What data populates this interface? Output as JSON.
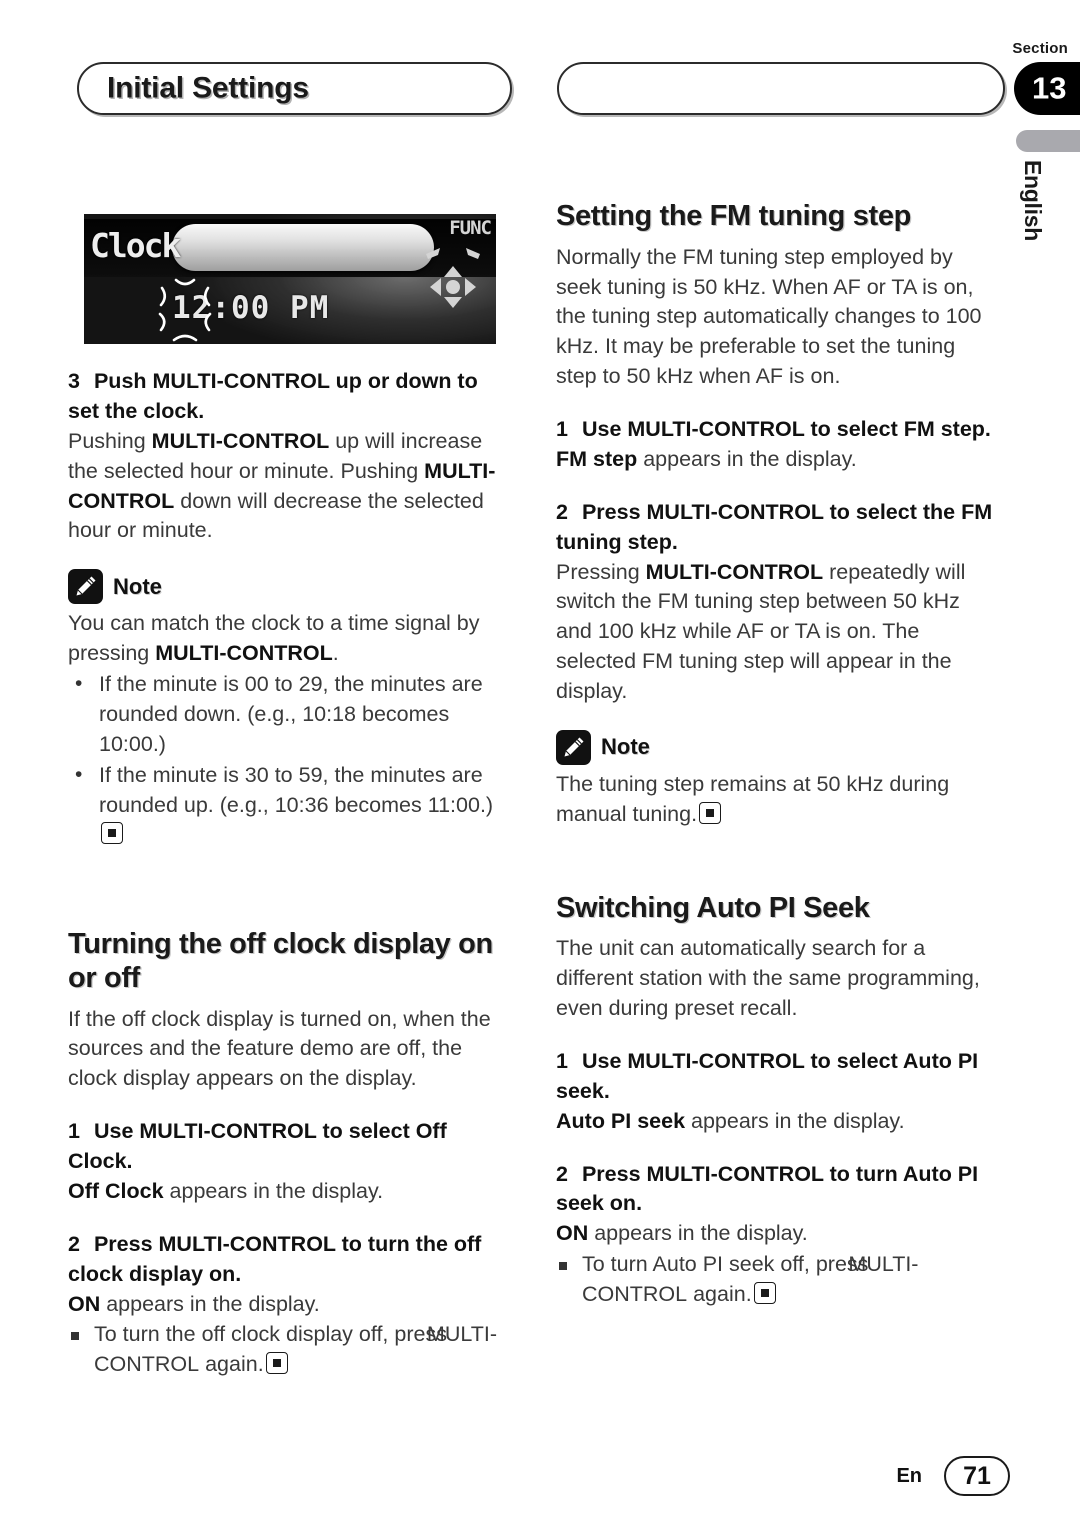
{
  "header": {
    "title": "Initial Settings",
    "right_pill_title": "",
    "section_label": "Section",
    "section_number": "13"
  },
  "side_tab": {
    "language": "English"
  },
  "lcd_display": {
    "alt": "car-stereo-lcd-clock-setting",
    "label_text": "Clock",
    "time_text": "12:00 PM",
    "func_text": "FUNC",
    "blink_indicator": "blinking-digits",
    "dpad_indicator": "multi-control-dpad"
  },
  "left_column": {
    "step3": {
      "num": "3",
      "heading": "Push MULTI-CONTROL up or down to set the clock.",
      "body_1": "Pushing ",
      "body_b1": "MULTI-CONTROL",
      "body_2": " up will increase the selected hour or minute. Pushing ",
      "body_b2": "MULTI-CONTROL",
      "body_3": " down will decrease the selected hour or minute."
    },
    "note": {
      "label": "Note",
      "icon": "pencil-note-icon",
      "text_1": "You can match the clock to a time signal by pressing ",
      "text_b1": "MULTI-CONTROL",
      "text_2": ".",
      "bullets": [
        {
          "p1": "If the minute is ",
          "b1": "00",
          "p2": " to ",
          "b2": "29",
          "p3": ", the minutes are rounded down. (e.g., ",
          "b3": "10:18",
          "p4": " becomes ",
          "b4": "10:00",
          "p5": ".)",
          "eos": false
        },
        {
          "p1": "If the minute is ",
          "b1": "30",
          "p2": " to ",
          "b2": "59",
          "p3": ", the minutes are rounded up. (e.g., ",
          "b3": "10:36",
          "p4": " becomes ",
          "b4": "11:00",
          "p5": ".)",
          "eos": true
        }
      ]
    },
    "section2": {
      "heading": "Turning the off clock display on or off",
      "intro": "If the off clock display is turned on, when the sources and the feature demo are off, the clock display appears on the display.",
      "step1": {
        "num": "1",
        "heading": "Use MULTI-CONTROL to select Off Clock.",
        "result_b": "Off Clock",
        "result_t": " appears in the display."
      },
      "step2": {
        "num": "2",
        "heading": "Press MULTI-CONTROL to turn the off clock display on.",
        "result_b": "ON",
        "result_t": " appears in the display.",
        "bullet_1": "To turn the off clock display off, press ",
        "bullet_b": "MULTI-CONTROL",
        "bullet_2": " again."
      }
    }
  },
  "right_column": {
    "section1": {
      "heading": "Setting the FM tuning step",
      "intro": "Normally the FM tuning step employed by seek tuning is 50 kHz. When AF or TA is on, the tuning step automatically changes to 100 kHz. It may be preferable to set the tuning step to 50 kHz when AF is on.",
      "step1": {
        "num": "1",
        "heading": "Use MULTI-CONTROL to select FM step.",
        "result_b": "FM step",
        "result_t": " appears in the display."
      },
      "step2": {
        "num": "2",
        "heading": "Press MULTI-CONTROL to select the FM tuning step.",
        "body_1": "Pressing ",
        "body_b1": "MULTI-CONTROL",
        "body_2": " repeatedly will switch the FM tuning step between 50 kHz and 100 kHz while AF or TA is on. The selected FM tuning step will appear in the display."
      },
      "note": {
        "label": "Note",
        "icon": "pencil-note-icon",
        "text": "The tuning step remains at 50 kHz during manual tuning."
      }
    },
    "section2": {
      "heading": "Switching Auto PI Seek",
      "intro": "The unit can automatically search for a different station with the same programming, even during preset recall.",
      "step1": {
        "num": "1",
        "heading": "Use MULTI-CONTROL to select Auto PI seek.",
        "result_b": "Auto PI seek",
        "result_t": " appears in the display."
      },
      "step2": {
        "num": "2",
        "heading": "Press MULTI-CONTROL to turn Auto PI seek on.",
        "result_b": "ON",
        "result_t": " appears in the display.",
        "bullet_1": "To turn Auto PI seek off, press ",
        "bullet_b": "MULTI-CONTROL",
        "bullet_2": " again."
      }
    }
  },
  "footer": {
    "language_code": "En",
    "page_number": "71"
  }
}
